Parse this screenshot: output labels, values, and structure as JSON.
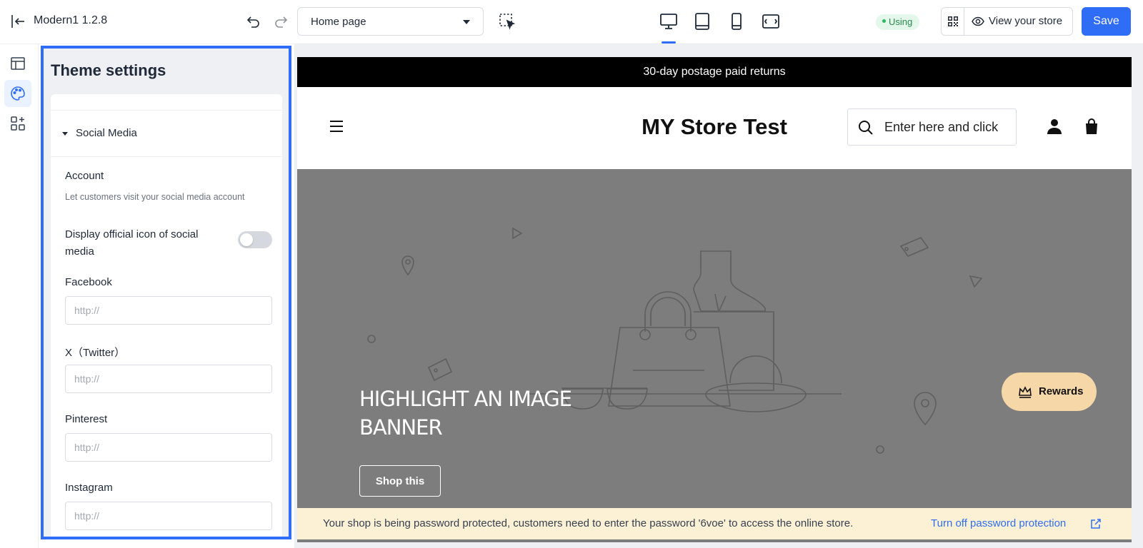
{
  "toolbar": {
    "app_name": "Modern1  1.2.8",
    "page_select": "Home page",
    "status_badge": "Using",
    "view_store_label": "View your store",
    "save_label": "Save"
  },
  "panel": {
    "title": "Theme settings",
    "section_title": "Social Media",
    "account_title": "Account",
    "account_desc": "Let customers visit your social media account",
    "toggle_label": "Display official icon of social media",
    "fields": [
      {
        "label": "Facebook",
        "placeholder": "http://"
      },
      {
        "label": "X（Twitter）",
        "placeholder": "http://"
      },
      {
        "label": "Pinterest",
        "placeholder": "http://"
      },
      {
        "label": "Instagram",
        "placeholder": "http://"
      }
    ]
  },
  "preview": {
    "announcement": "30-day postage paid returns",
    "store_name": "MY Store Test",
    "search_placeholder": "Enter here and click",
    "banner_heading": "HIGHLIGHT AN IMAGE BANNER",
    "shop_button": "Shop this",
    "rewards_label": "Rewards"
  },
  "password_bar": {
    "message": "Your shop is being password protected, customers need to enter the password '6voe' to access the online store.",
    "link": "Turn off password protection"
  },
  "colors": {
    "accent": "#2f6df6",
    "banner_bg": "#7d7d7d",
    "rewards_bg": "#f6d7a7",
    "password_bar_bg": "#fcf0d5"
  }
}
